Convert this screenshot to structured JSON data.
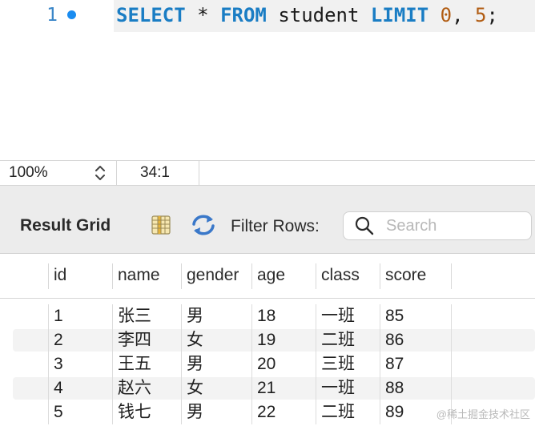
{
  "editor": {
    "line_number": "1",
    "tokens": {
      "select": "SELECT",
      "star": "*",
      "from": "FROM",
      "table": "student",
      "limit": "LIMIT",
      "offset": "0",
      "comma": ",",
      "count": "5",
      "semicolon": ";"
    }
  },
  "statusbar": {
    "zoom": "100%",
    "cursor_position": "34:1"
  },
  "toolbar": {
    "title": "Result Grid",
    "filter_label": "Filter Rows:",
    "search_placeholder": "Search"
  },
  "grid": {
    "columns": [
      "id",
      "name",
      "gender",
      "age",
      "class",
      "score"
    ],
    "rows": [
      [
        "1",
        "张三",
        "男",
        "18",
        "一班",
        "85"
      ],
      [
        "2",
        "李四",
        "女",
        "19",
        "二班",
        "86"
      ],
      [
        "3",
        "王五",
        "男",
        "20",
        "三班",
        "87"
      ],
      [
        "4",
        "赵六",
        "女",
        "21",
        "一班",
        "88"
      ],
      [
        "5",
        "钱七",
        "男",
        "22",
        "二班",
        "89"
      ]
    ]
  },
  "watermark": "@稀土掘金技术社区",
  "colors": {
    "keyword": "#1a7dc4",
    "number": "#b15c12",
    "line_number": "#3a86c8",
    "breakpoint_dot": "#1a8cf0"
  },
  "icons": [
    "line-dot-icon",
    "stepper-icon",
    "grid-view-icon",
    "refresh-icon",
    "search-icon"
  ]
}
